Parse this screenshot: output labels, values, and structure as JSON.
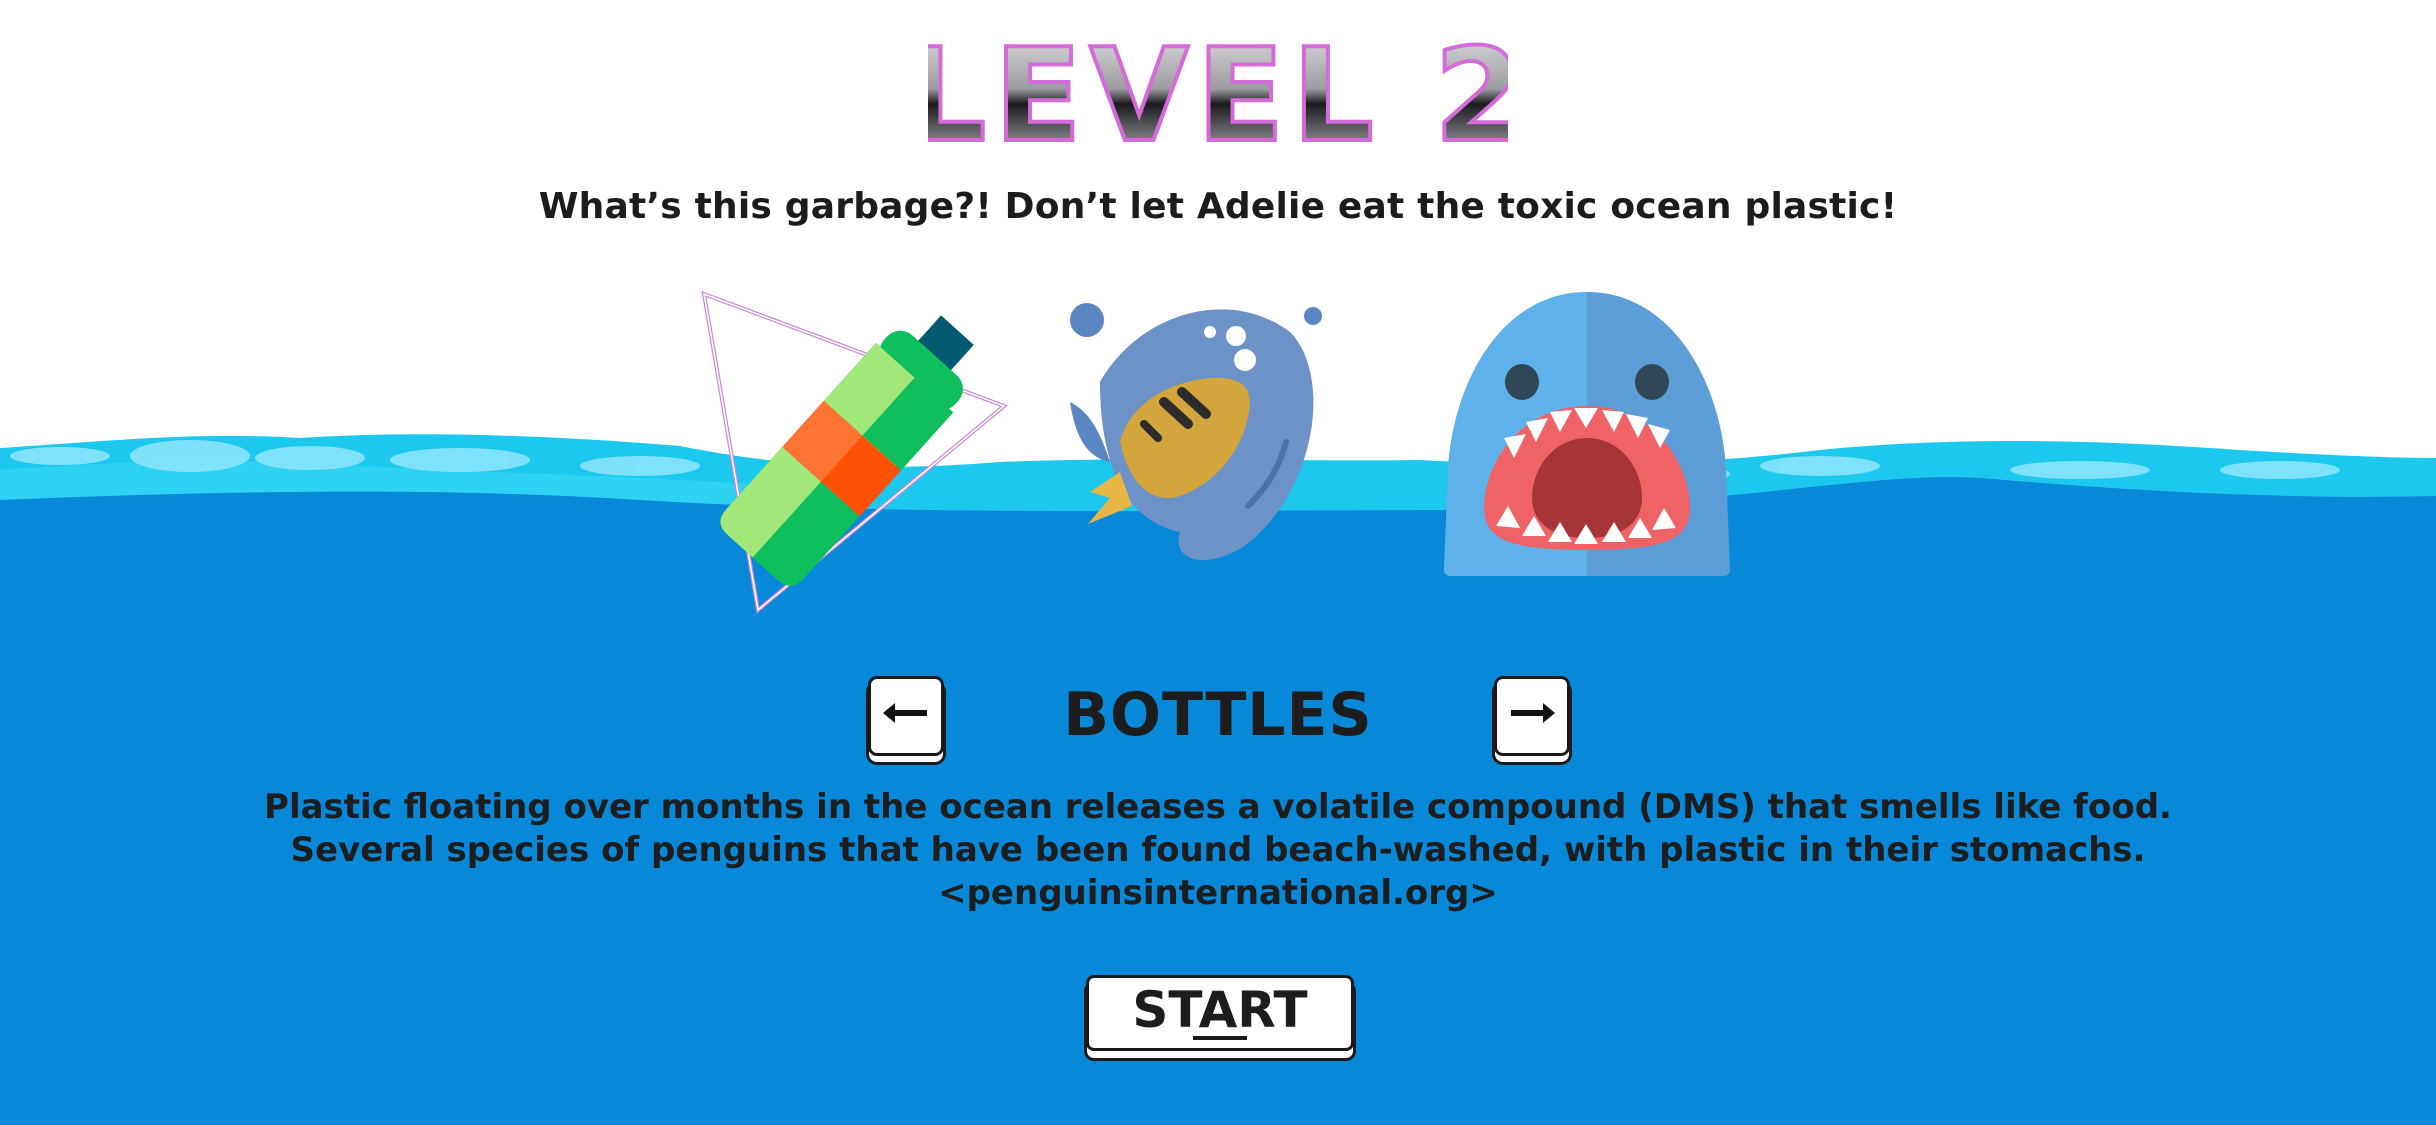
{
  "level": {
    "title": "LEVEL 2"
  },
  "subtitle": "What’s this garbage?! Don’t let Adelie eat the toxic ocean plastic!",
  "characters": {
    "icons": [
      "bottle-icon",
      "fish-icon",
      "shark-icon"
    ]
  },
  "selector": {
    "item_name": "BOTTLES",
    "prev_icon": "left-arrow-icon",
    "next_icon": "right-arrow-icon"
  },
  "info": {
    "line1": "Plastic floating over months in the ocean releases a volatile compound (DMS) that smells like food.",
    "line2": "Several species of penguins that have been found beach-washed, with plastic in their stomachs.",
    "source": "<penguinsinternational.org>"
  },
  "start_button": {
    "label": "START"
  },
  "colors": {
    "ocean": "#0788d9",
    "wave_light": "#1dc8ef",
    "text": "#1d1d1d"
  }
}
